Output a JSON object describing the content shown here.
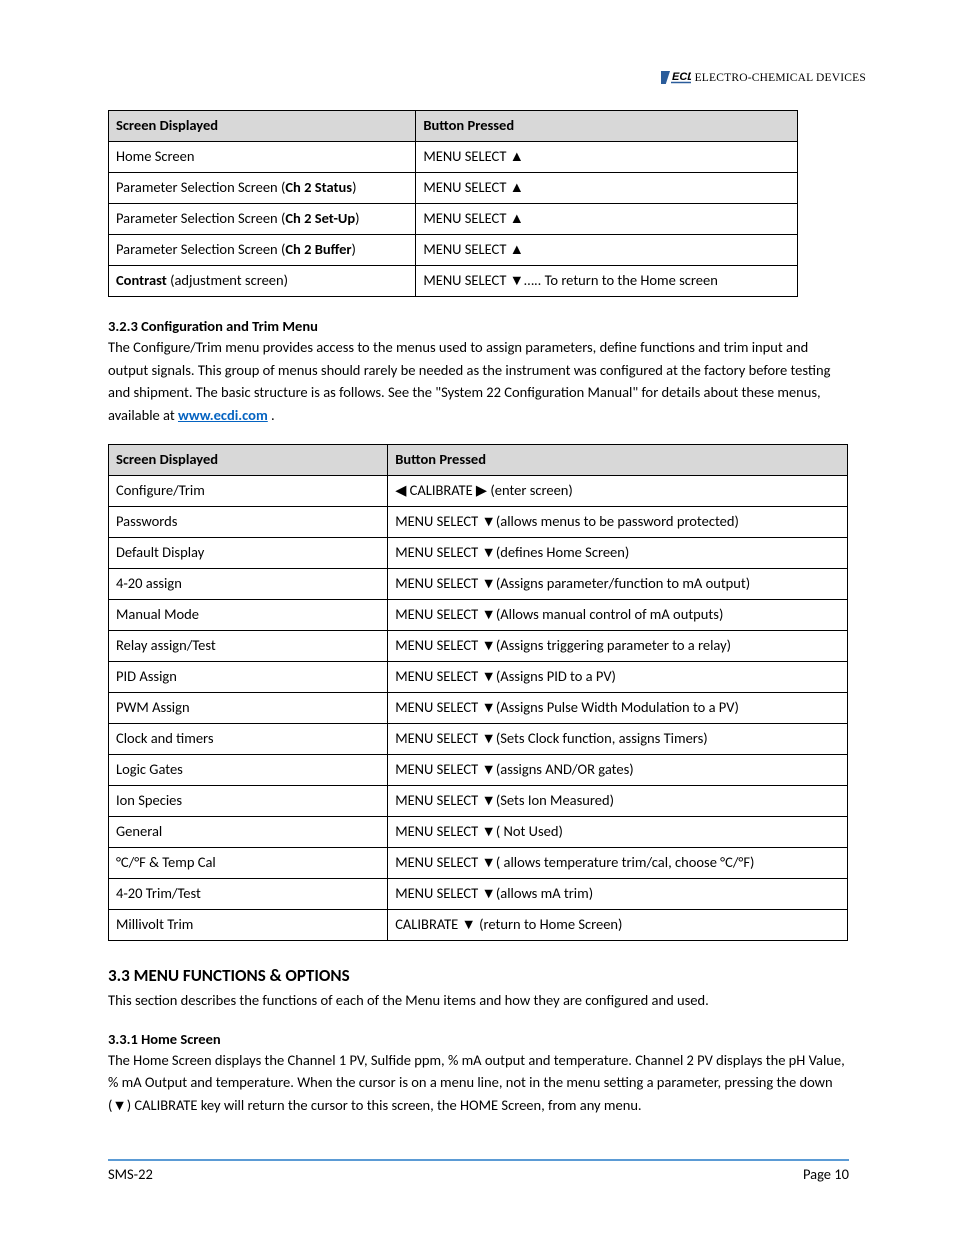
{
  "brand": {
    "name": "ELECTRO-CHEMICAL DEVICES",
    "logo_text": "ECD"
  },
  "table1": {
    "headers": [
      "Screen Displayed",
      "Button Pressed"
    ],
    "rows": [
      {
        "screen": "Home Screen",
        "bold": "",
        "button": "MENU SELECT ▲"
      },
      {
        "screen": "Parameter Selection Screen (",
        "bold": "Ch 2 Status",
        "after": ")",
        "button": "MENU SELECT ▲"
      },
      {
        "screen": "Parameter Selection Screen (",
        "bold": "Ch 2 Set-Up",
        "after": ")",
        "button": "MENU SELECT ▲"
      },
      {
        "screen": "Parameter Selection Screen (",
        "bold": "Ch 2 Buffer",
        "after": ")",
        "button": "MENU SELECT ▲"
      },
      {
        "screen_bold": "Contrast",
        "screen_after": " (adjustment screen)",
        "button": "MENU SELECT ▼….. To return to the Home screen"
      }
    ]
  },
  "section_323": {
    "heading": "3.2.3 Configuration and Trim Menu",
    "body_before_link": "The Configure/Trim menu provides access to the menus used to assign parameters, define functions and trim input and output signals. This group of menus should rarely be needed as the instrument was configured at the factory before testing and shipment. The basic structure is as follows. See the \"System 22 Configuration Manual\" for details about these menus, available at ",
    "link_text": "www.ecdi.com",
    "body_after_link": " ."
  },
  "table2": {
    "headers": [
      "Screen Displayed",
      "Button Pressed"
    ],
    "rows": [
      {
        "screen": "Configure/Trim",
        "button": "◀ CALIBRATE ▶  (enter screen)"
      },
      {
        "screen": "Passwords",
        "button": "MENU SELECT ▼(allows menus to be password protected)"
      },
      {
        "screen": "Default Display",
        "button": "MENU SELECT ▼(defines Home Screen)"
      },
      {
        "screen": "4-20 assign",
        "button": "MENU SELECT ▼(Assigns parameter/function to mA output)"
      },
      {
        "screen": "Manual Mode",
        "button": "MENU SELECT ▼(Allows manual control of mA outputs)"
      },
      {
        "screen": "Relay assign/Test",
        "button": "MENU SELECT ▼(Assigns triggering parameter to a relay)"
      },
      {
        "screen": "PID Assign",
        "button": "MENU SELECT ▼(Assigns PID to a PV)"
      },
      {
        "screen": "PWM Assign",
        "button": "MENU SELECT ▼(Assigns Pulse Width Modulation to a PV)"
      },
      {
        "screen": "Clock and timers",
        "button": "MENU SELECT ▼(Sets Clock function, assigns Timers)"
      },
      {
        "screen": "Logic Gates",
        "button": "MENU SELECT ▼(assigns AND/OR gates)"
      },
      {
        "screen": "Ion Species",
        "button": "MENU SELECT ▼(Sets Ion Measured)"
      },
      {
        "screen": "General",
        "button": "MENU SELECT ▼( Not Used)"
      },
      {
        "screen": "°C/°F & Temp Cal",
        "button": "MENU SELECT ▼( allows temperature trim/cal, choose °C/°F)"
      },
      {
        "screen": "4-20 Trim/Test",
        "button": "MENU SELECT ▼(allows mA trim)"
      },
      {
        "screen": "Millivolt Trim",
        "button": "CALIBRATE ▼ (return to Home Screen)"
      }
    ]
  },
  "section_33": {
    "heading": "3.3 MENU FUNCTIONS & OPTIONS",
    "body": "This section describes the functions of each of the Menu items and how they are configured and used."
  },
  "section_331": {
    "heading": "3.3.1 Home Screen",
    "body": "The Home Screen displays the Channel 1 PV, Sulfide ppm, % mA output and temperature. Channel 2 PV displays the pH Value, % mA Output and temperature. When the cursor is on a menu line, not in the menu setting a parameter, pressing the down (▼) CALIBRATE key will return the cursor to this screen, the HOME Screen, from any menu."
  },
  "footer": {
    "left": "SMS-22",
    "right": "Page 10"
  }
}
